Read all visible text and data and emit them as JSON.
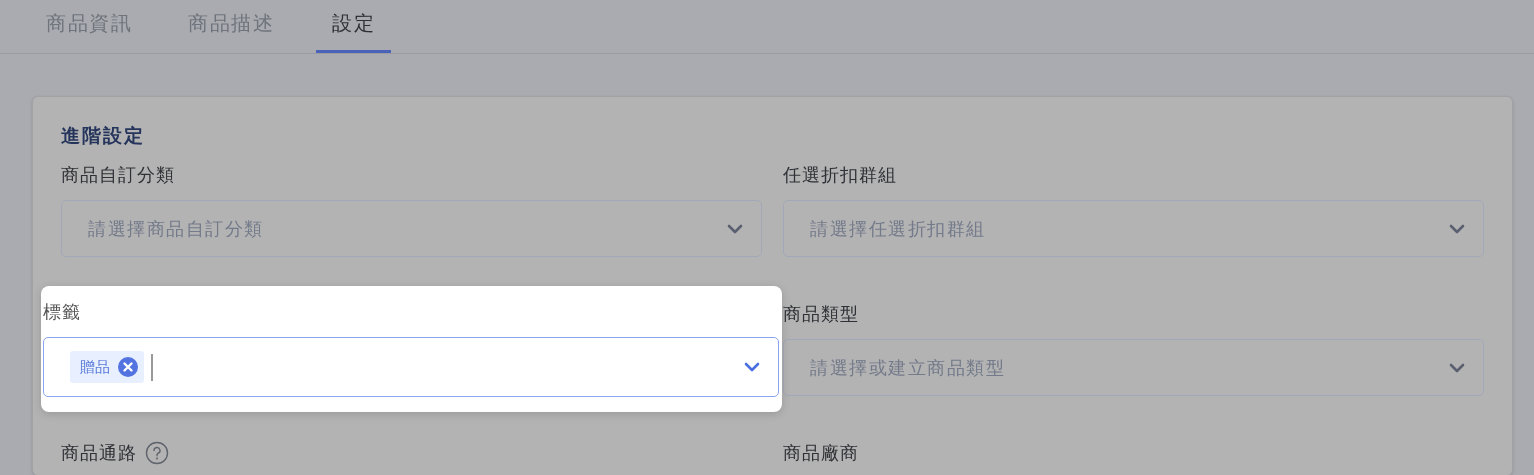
{
  "tabs": [
    {
      "label": "商品資訊",
      "selected": false
    },
    {
      "label": "商品描述",
      "selected": false
    },
    {
      "label": "設定",
      "selected": true
    }
  ],
  "section": {
    "title": "進階設定",
    "fields": [
      {
        "kind": "select",
        "label": "商品自訂分類",
        "placeholder": "請選擇商品自訂分類",
        "highlighted": false,
        "help": false
      },
      {
        "kind": "select",
        "label": "任選折扣群組",
        "placeholder": "請選擇任選折扣群組",
        "highlighted": false,
        "help": false
      },
      {
        "kind": "tags",
        "label": "標籤",
        "tags": [
          "贈品"
        ],
        "highlighted": true,
        "help": false
      },
      {
        "kind": "select",
        "label": "商品類型",
        "placeholder": "請選擇或建立商品類型",
        "highlighted": false,
        "help": false
      },
      {
        "kind": "label",
        "label": "商品通路",
        "highlighted": false,
        "help": true
      },
      {
        "kind": "label",
        "label": "商品廠商",
        "highlighted": false,
        "help": false
      }
    ]
  }
}
